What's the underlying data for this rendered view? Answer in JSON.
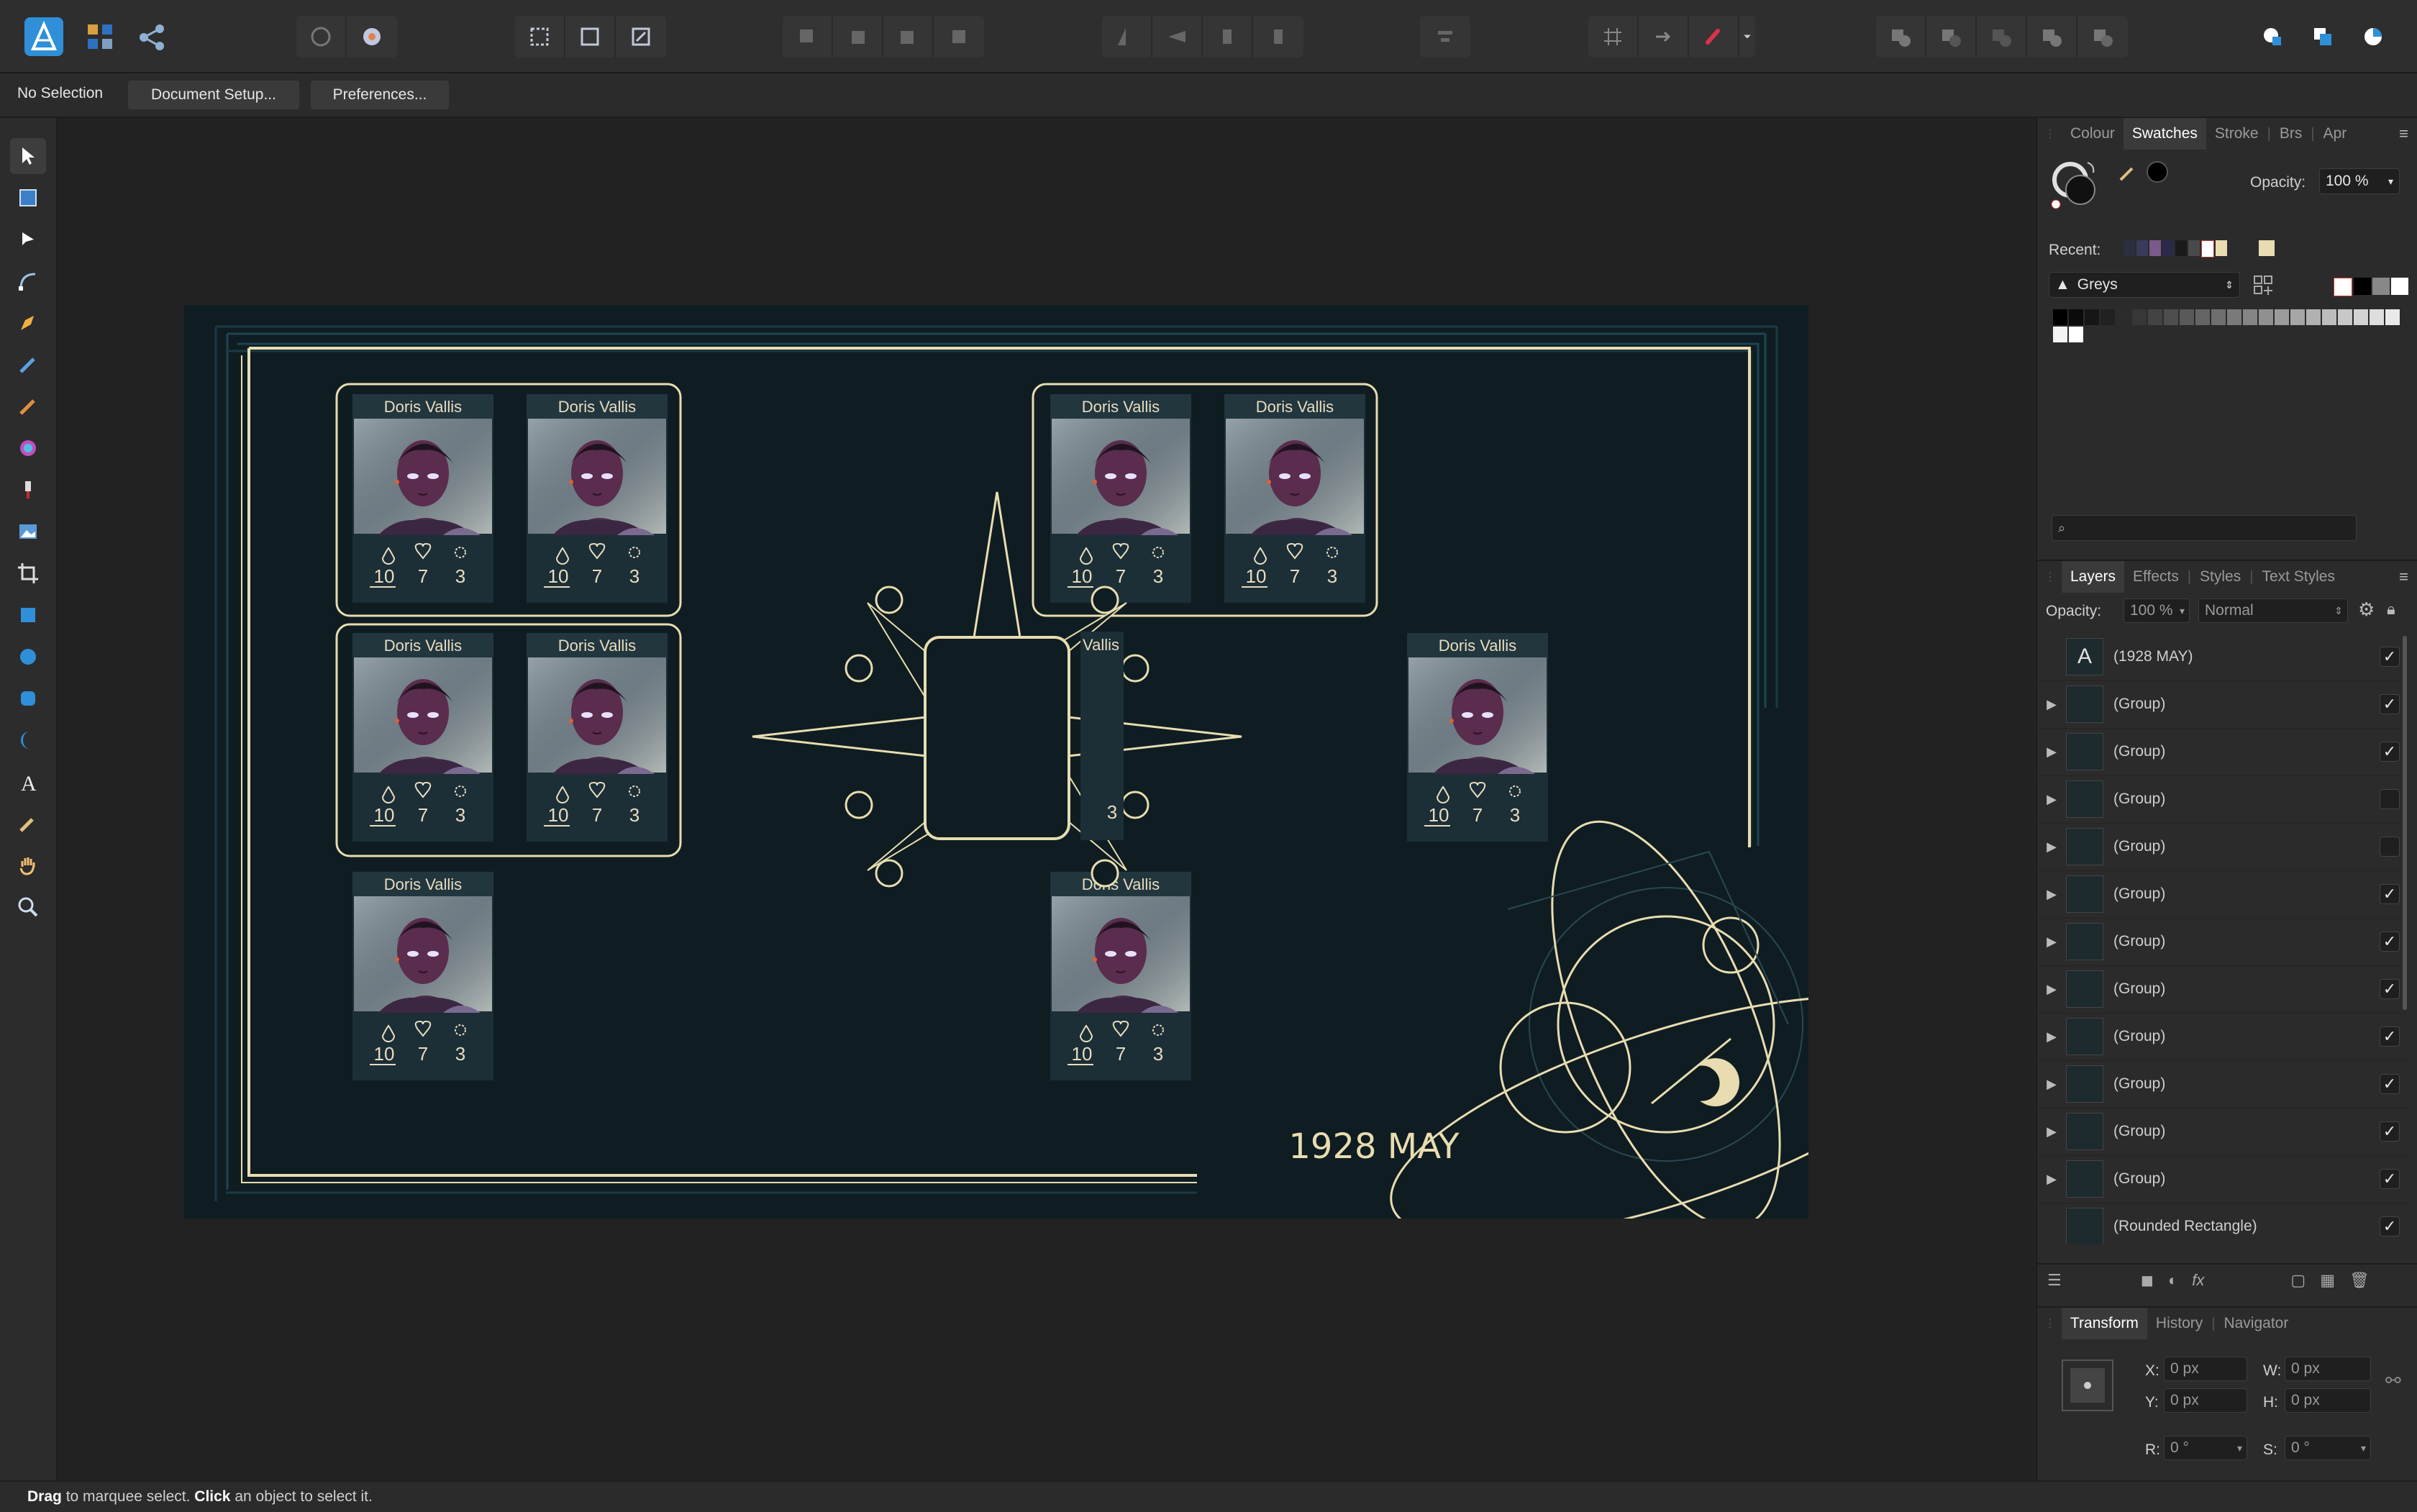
{
  "context_bar": {
    "selection": "No Selection",
    "document_setup": "Document Setup...",
    "preferences": "Preferences..."
  },
  "document": {
    "date_text": "1928 MAY",
    "card_name": "Doris Vallis",
    "card_name_partial": "Vallis",
    "stats": [
      "10",
      "7",
      "3"
    ],
    "partial_stat": "3"
  },
  "colour_panel": {
    "tabs": [
      "Colour",
      "Swatches",
      "Stroke",
      "Brs",
      "Apr"
    ],
    "active_tab": "Swatches",
    "opacity_label": "Opacity:",
    "opacity_value": "100 %",
    "recent_label": "Recent:",
    "palette": "Greys"
  },
  "layers_panel": {
    "tabs": [
      "Layers",
      "Effects",
      "Styles",
      "Text Styles"
    ],
    "active_tab": "Layers",
    "opacity_label": "Opacity:",
    "opacity_value": "100 %",
    "blend_mode": "Normal",
    "layers": [
      {
        "name": "(1928 MAY)",
        "type": "text",
        "visible": true
      },
      {
        "name": "(Group)",
        "type": "group",
        "visible": true
      },
      {
        "name": "(Group)",
        "type": "group",
        "visible": true
      },
      {
        "name": "(Group)",
        "type": "group",
        "visible": false
      },
      {
        "name": "(Group)",
        "type": "group",
        "visible": false
      },
      {
        "name": "(Group)",
        "type": "group",
        "visible": true
      },
      {
        "name": "(Group)",
        "type": "group",
        "visible": true
      },
      {
        "name": "(Group)",
        "type": "group",
        "visible": true
      },
      {
        "name": "(Group)",
        "type": "group",
        "visible": true
      },
      {
        "name": "(Group)",
        "type": "group",
        "visible": true
      },
      {
        "name": "(Group)",
        "type": "group",
        "visible": true
      },
      {
        "name": "(Group)",
        "type": "group",
        "visible": true
      },
      {
        "name": "(Rounded Rectangle)",
        "type": "shape",
        "visible": true
      }
    ]
  },
  "transform_panel": {
    "tabs": [
      "Transform",
      "History",
      "Navigator"
    ],
    "active_tab": "Transform",
    "x_label": "X:",
    "x_value": "0 px",
    "y_label": "Y:",
    "y_value": "0 px",
    "w_label": "W:",
    "w_value": "0 px",
    "h_label": "H:",
    "h_value": "0 px",
    "r_label": "R:",
    "r_value": "0 °",
    "s_label": "S:",
    "s_value": "0 °"
  },
  "status_bar": {
    "drag": "Drag",
    "drag_text": " to marquee select. ",
    "click": "Click",
    "click_text": " an object to select it."
  },
  "colors": {
    "accent_blue": "#2f8fd8",
    "document_bg": "#0f1d22",
    "ornament_cream": "#e8dcb0",
    "card_bg": "#1c2e36",
    "magnet_red": "#d8334a"
  },
  "icons": {
    "app": "affinity-designer-logo",
    "tools": [
      "move-tool-icon",
      "artboard-tool-icon",
      "node-tool-icon",
      "corner-tool-icon",
      "pen-tool-icon",
      "pencil-tool-icon",
      "vector-brush-tool-icon",
      "fill-tool-icon",
      "transparency-tool-icon",
      "place-image-tool-icon",
      "crop-tool-icon",
      "rectangle-tool-icon",
      "ellipse-tool-icon",
      "rounded-rectangle-tool-icon",
      "crescent-tool-icon",
      "text-tool-icon",
      "color-picker-tool-icon",
      "hand-tool-icon",
      "zoom-tool-icon"
    ]
  }
}
